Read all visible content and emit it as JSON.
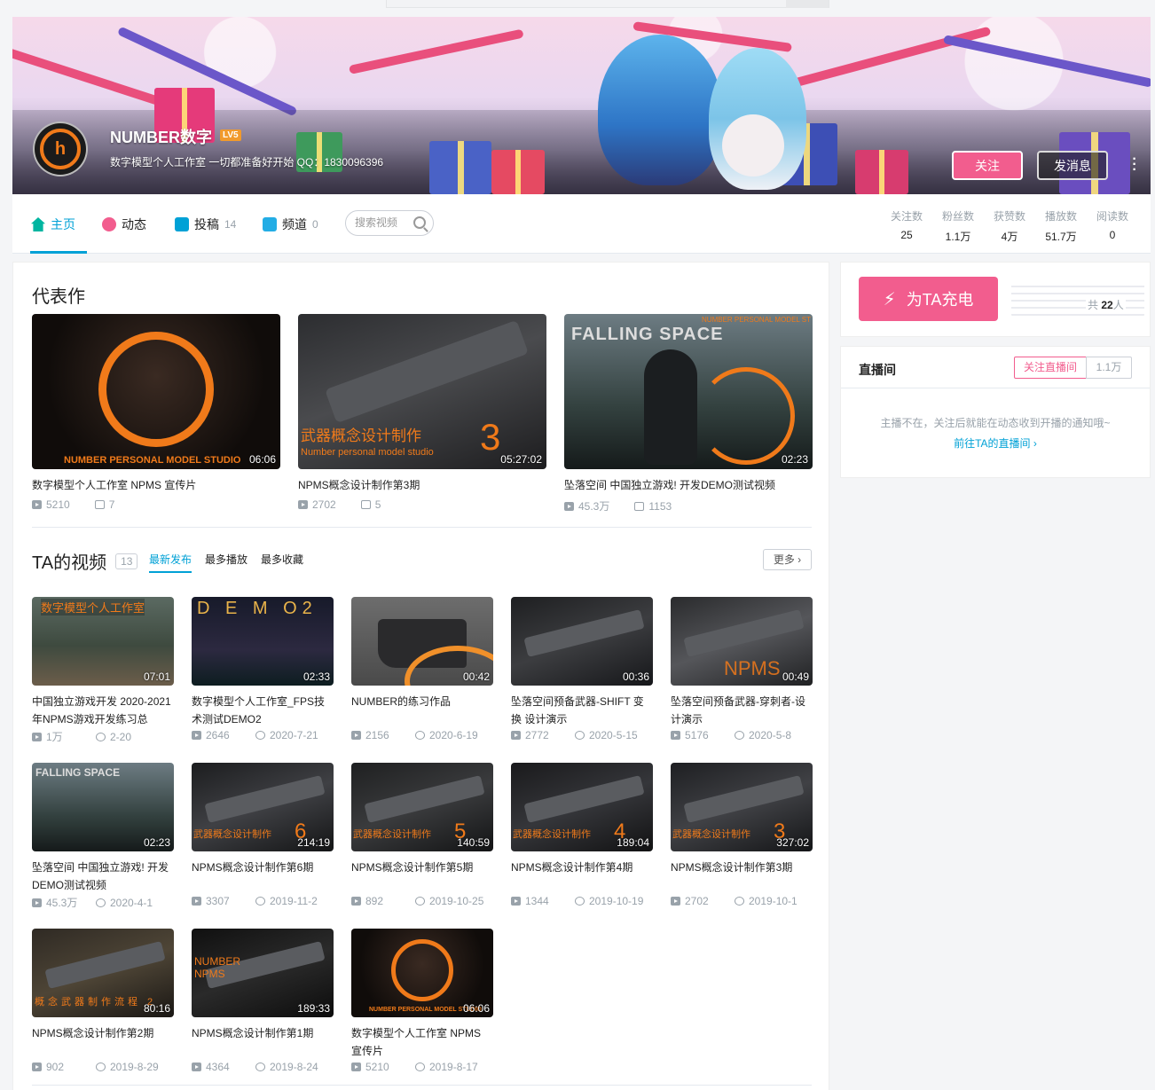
{
  "header": {
    "user_name": "NUMBER数字",
    "level": "LV5",
    "sign": "数字模型个人工作室 一切都准备好开始 QQ：1830096396",
    "follow_label": "关注",
    "message_label": "发消息",
    "avatar_text": "h"
  },
  "nav": {
    "home": "主页",
    "dynamic": "动态",
    "posts": "投稿",
    "posts_count": "14",
    "channel": "频道",
    "channel_count": "0",
    "search_placeholder": "搜索视频"
  },
  "stats": [
    {
      "label": "关注数",
      "value": "25"
    },
    {
      "label": "粉丝数",
      "value": "1.1万"
    },
    {
      "label": "获赞数",
      "value": "4万"
    },
    {
      "label": "播放数",
      "value": "51.7万"
    },
    {
      "label": "阅读数",
      "value": "0"
    }
  ],
  "featured": {
    "title": "代表作",
    "items": [
      {
        "title": "数字模型个人工作室 NPMS 宣传片",
        "duration": "06:06",
        "plays": "5210",
        "danmaku": "7",
        "overlay": "NUMBER PERSONAL MODEL STUDIO"
      },
      {
        "title": "NPMS概念设计制作第3期",
        "duration": "05:27:02",
        "plays": "2702",
        "danmaku": "5",
        "overlay": "武器概念设计制作",
        "overlay_sub": "Number personal model studio",
        "overlay_num": "3"
      },
      {
        "title": "坠落空间 中国独立游戏! 开发DEMO测试视频",
        "duration": "02:23",
        "plays": "45.3万",
        "danmaku": "1153",
        "overlay": "FALLING SPACE",
        "overlay_sub": "NUMBER PERSONAL MODEL ST"
      }
    ]
  },
  "videos": {
    "title": "TA的视频",
    "count": "13",
    "tabs": [
      "最新发布",
      "最多播放",
      "最多收藏"
    ],
    "more": "更多",
    "items": [
      {
        "title": "中国独立游戏开发 2020-2021年NPMS游戏开发练习总",
        "duration": "07:01",
        "plays": "1万",
        "date": "2-20",
        "overlay": "数字模型个人工作室"
      },
      {
        "title": "数字模型个人工作室_FPS技术测试DEMO2",
        "duration": "02:33",
        "plays": "2646",
        "date": "2020-7-21",
        "overlay": "D E M O2"
      },
      {
        "title": "NUMBER的练习作品",
        "duration": "00:42",
        "plays": "2156",
        "date": "2020-6-19"
      },
      {
        "title": "坠落空间预备武器-SHIFT 变换 设计演示",
        "duration": "00:36",
        "plays": "2772",
        "date": "2020-5-15"
      },
      {
        "title": "坠落空间预备武器-穿刺者-设计演示",
        "duration": "00:49",
        "plays": "5176",
        "date": "2020-5-8",
        "overlay": "NPMS"
      },
      {
        "title": "坠落空间 中国独立游戏! 开发DEMO测试视频",
        "duration": "02:23",
        "plays": "45.3万",
        "date": "2020-4-1",
        "overlay": "FALLING SPACE"
      },
      {
        "title": "NPMS概念设计制作第6期",
        "duration": "214:19",
        "plays": "3307",
        "date": "2019-11-2",
        "overlay": "武器概念设计制作",
        "overlay_num": "6"
      },
      {
        "title": "NPMS概念设计制作第5期",
        "duration": "140:59",
        "plays": "892",
        "date": "2019-10-25",
        "overlay": "武器概念设计制作",
        "overlay_num": "5"
      },
      {
        "title": "NPMS概念设计制作第4期",
        "duration": "189:04",
        "plays": "1344",
        "date": "2019-10-19",
        "overlay": "武器概念设计制作",
        "overlay_num": "4"
      },
      {
        "title": "NPMS概念设计制作第3期",
        "duration": "327:02",
        "plays": "2702",
        "date": "2019-10-1",
        "overlay": "武器概念设计制作",
        "overlay_num": "3"
      },
      {
        "title": "NPMS概念设计制作第2期",
        "duration": "80:16",
        "plays": "902",
        "date": "2019-8-29",
        "overlay": "概念武器制作流程 2"
      },
      {
        "title": "NPMS概念设计制作第1期",
        "duration": "189:33",
        "plays": "4364",
        "date": "2019-8-24",
        "overlay": "NUMBER NPMS"
      },
      {
        "title": "数字模型个人工作室 NPMS 宣传片",
        "duration": "06:06",
        "plays": "5210",
        "date": "2019-8-17",
        "overlay": "NUMBER PERSONAL MODEL STUDIO"
      }
    ]
  },
  "side": {
    "charge_label": "为TA充电",
    "charge_count_prefix": "共",
    "charge_count": "22",
    "charge_count_suffix": "人",
    "live_title": "直播间",
    "live_follow": "关注直播间",
    "live_count": "1.1万",
    "live_tip": "主播不在，关注后就能在动态收到开播的通知哦~",
    "live_link": "前往TA的直播间"
  },
  "colors": {
    "accent_blue": "#00a1d6",
    "accent_pink": "#f25d8e",
    "brand_orange": "#f07a1a"
  }
}
